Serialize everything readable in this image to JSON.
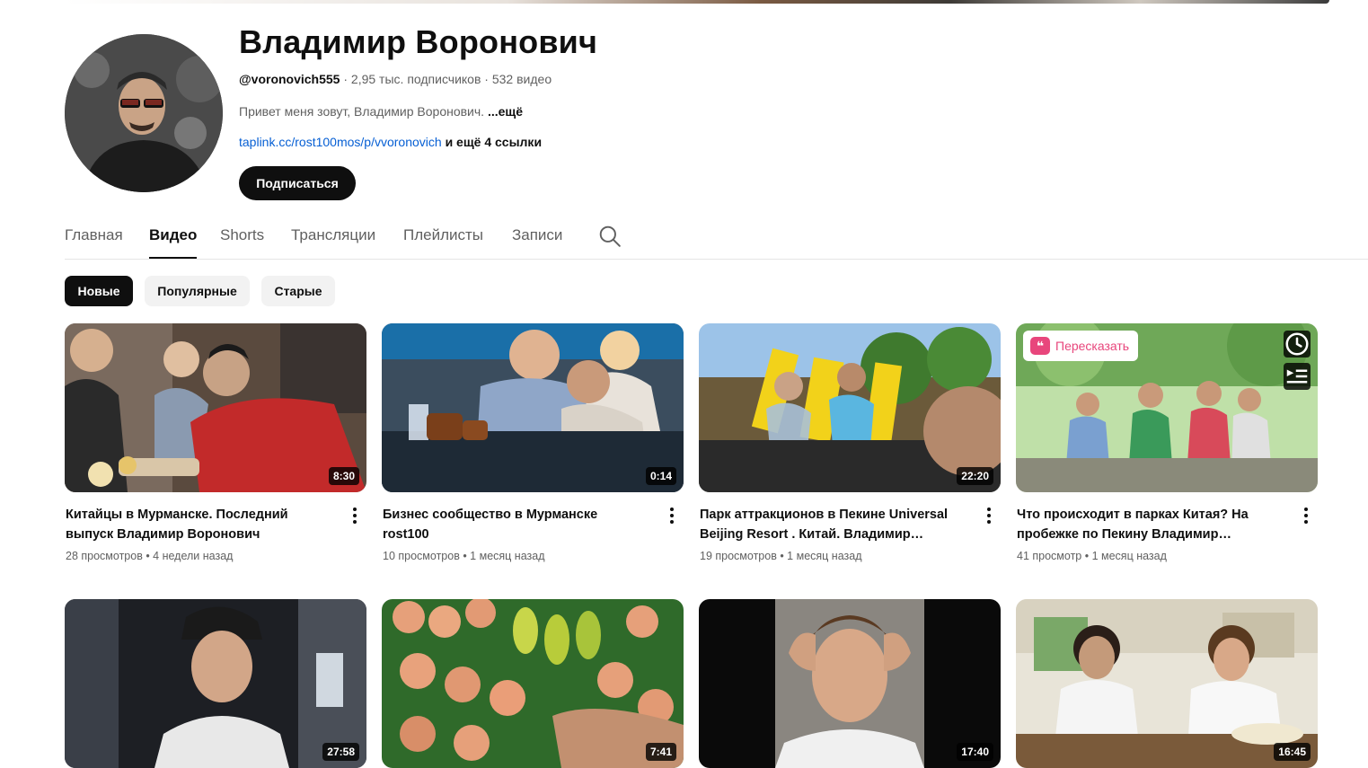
{
  "channel": {
    "name": "Владимир Воронович",
    "handle": "@voronovich555",
    "subscribers": "2,95 тыс. подписчиков",
    "video_count": "532 видео",
    "separator": "·",
    "description": "Привет меня зовут, Владимир Воронович.",
    "more_label": "...ещё",
    "link": "taplink.cc/rost100mos/p/vvoronovich",
    "extra_links": "и ещё 4 ссылки",
    "subscribe_label": "Подписаться"
  },
  "tabs": [
    {
      "label": "Главная",
      "active": false
    },
    {
      "label": "Видео",
      "active": true
    },
    {
      "label": "Shorts",
      "active": false
    },
    {
      "label": "Трансляции",
      "active": false
    },
    {
      "label": "Плейлисты",
      "active": false
    },
    {
      "label": "Записи",
      "active": false
    }
  ],
  "filters": [
    {
      "label": "Новые",
      "active": true
    },
    {
      "label": "Популярные",
      "active": false
    },
    {
      "label": "Старые",
      "active": false
    }
  ],
  "videos": [
    {
      "title": "Китайцы в Мурманске. Последний выпуск Владимир Воронович",
      "views": "28 просмотров",
      "age": "4 недели назад",
      "duration": "8:30"
    },
    {
      "title": " Бизнес сообщество в Мурманске rost100",
      "views": "10 просмотров",
      "age": "1 месяц назад",
      "duration": "0:14"
    },
    {
      "title": "Парк аттракционов в Пекине Universal Beijing Resort . Китай. Владимир Воронович",
      "views": "19 просмотров",
      "age": "1 месяц назад",
      "duration": "22:20"
    },
    {
      "title": "Что происходит в парках Китая? На пробежке по Пекину Владимир Воронович",
      "views": "41 просмотр",
      "age": "1 месяц назад",
      "duration": "",
      "retell_label": "Пересказать"
    },
    {
      "title": "",
      "views": "",
      "age": "",
      "duration": "27:58"
    },
    {
      "title": "",
      "views": "",
      "age": "",
      "duration": "7:41"
    },
    {
      "title": "",
      "views": "",
      "age": "",
      "duration": "17:40"
    },
    {
      "title": "",
      "views": "",
      "age": "",
      "duration": "16:45"
    }
  ],
  "icons": {
    "search": "search-icon",
    "more": "more-vert-icon",
    "watch_later": "clock-icon",
    "add_to_queue": "queue-icon",
    "retell": "quote-icon"
  },
  "colors": {
    "accent": "#0f0f0f",
    "link": "#065fd4",
    "retell": "#e8467c",
    "secondary_text": "#606060"
  }
}
